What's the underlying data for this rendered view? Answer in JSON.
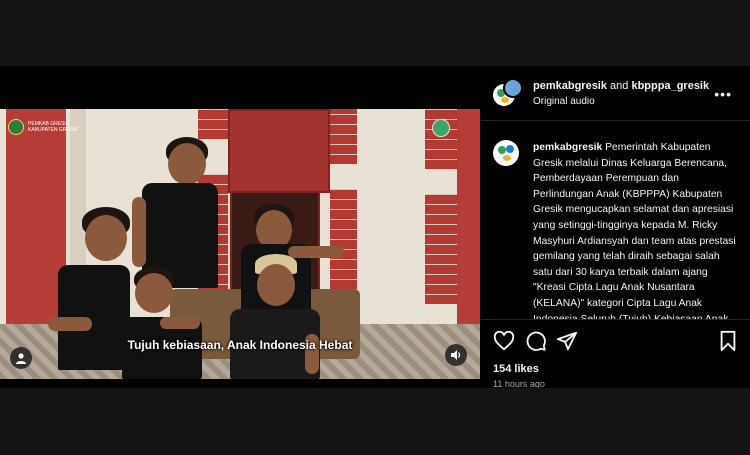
{
  "media": {
    "logo_left_text_line1": "PEMKAB GRESIK",
    "logo_left_text_line2": "KABUPATEN GRESIK",
    "subtitle": "Tujuh kebiasaan, Anak Indonesia Hebat"
  },
  "panel": {
    "account_primary": "pemkabgresik",
    "conjunction": "and",
    "account_secondary": "kbpppa_gresik",
    "audio": "Original audio",
    "more_icon": "more-horizontal-icon",
    "caption_author": "pemkabgresik",
    "caption_text": "Pemerintah Kabupaten Gresik melalui Dinas Keluarga Berencana, Pemberdayaan Perempuan dan Perlindungan Anak (KBPPPA) Kabupaten Gresik mengucapkan selamat dan apresiasi yang setinggi-tingginya kepada M. Ricky Masyhuri Ardiansyah dan team atas prestasi gemilang yang telah diraih sebagai salah satu dari 30 karya terbaik dalam ajang \"Kreasi Cipta Lagu Anak Nusantara (KELANA)\" kategori Cipta Lagu Anak Indonesia Seluruh (Tujuh) Kebiasaan Anak Indonesia"
  },
  "actions": {
    "icons": [
      "heart-icon",
      "comment-icon",
      "share-icon",
      "bookmark-icon"
    ],
    "likes": "154 likes",
    "time": "11 hours ago"
  },
  "colors": {
    "background": "#000000",
    "page_backdrop": "#141416",
    "divider": "#262626",
    "muted_text": "#a8a8a8"
  }
}
